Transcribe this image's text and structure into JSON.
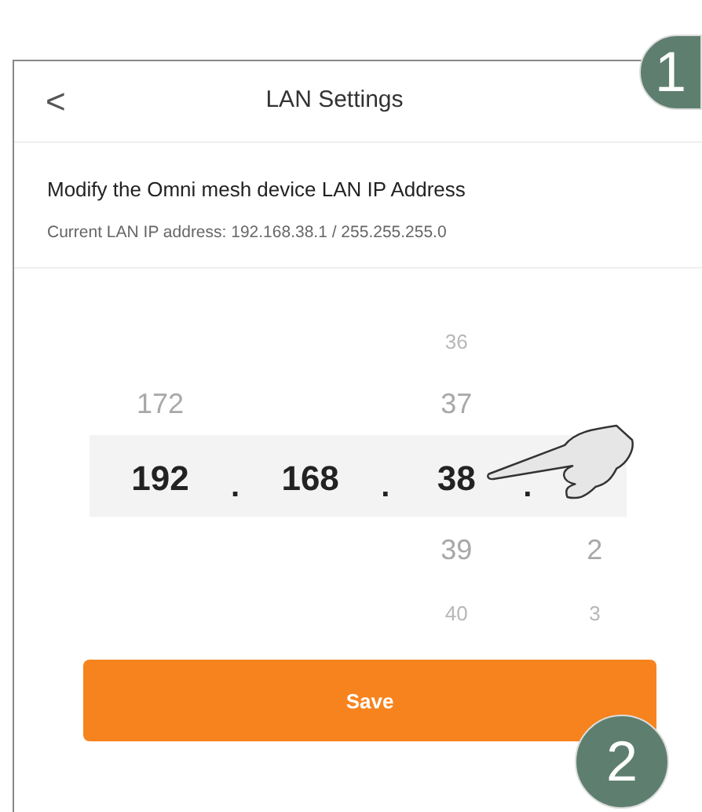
{
  "header": {
    "back": "<",
    "title": "LAN Settings"
  },
  "intro": {
    "heading": "Modify the Omni mesh device LAN IP Address",
    "current": "Current LAN IP address: 192.168.38.1 / 255.255.255.0"
  },
  "picker": {
    "separators": [
      ".",
      ".",
      "."
    ],
    "columns": [
      {
        "above": [
          "172"
        ],
        "selected": "192"
      },
      {
        "selected": "168"
      },
      {
        "above": [
          "36",
          "37"
        ],
        "selected": "38",
        "below": [
          "39",
          "40"
        ]
      },
      {
        "below": [
          "2",
          "3"
        ]
      }
    ]
  },
  "save_button": "Save",
  "steps": [
    {
      "label": "1"
    },
    {
      "label": "2"
    }
  ]
}
